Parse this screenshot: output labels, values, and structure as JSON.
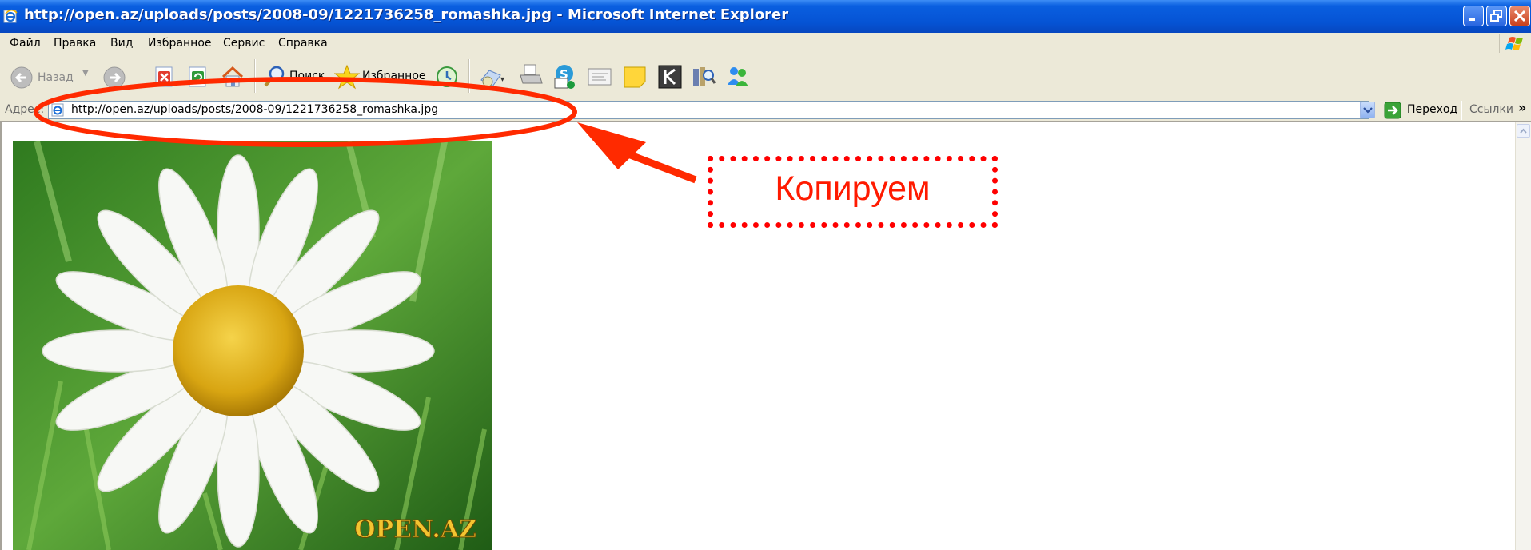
{
  "window": {
    "title": "http://open.az/uploads/posts/2008-09/1221736258_romashka.jpg - Microsoft Internet Explorer"
  },
  "menu": {
    "items": [
      "Файл",
      "Правка",
      "Вид",
      "Избранное",
      "Сервис",
      "Справка"
    ]
  },
  "toolbar": {
    "back_label": "Назад",
    "search_label": "Поиск",
    "favorites_label": "Избранное"
  },
  "address_bar": {
    "label": "Адрес:",
    "value": "http://open.az/uploads/posts/2008-09/1221736258_romashka.jpg",
    "go_label": "Переход",
    "links_label": "Ссылки"
  },
  "content": {
    "image_watermark": "OPEN.AZ"
  },
  "annotation": {
    "caption": "Копируем",
    "color": "#ff2a00"
  }
}
